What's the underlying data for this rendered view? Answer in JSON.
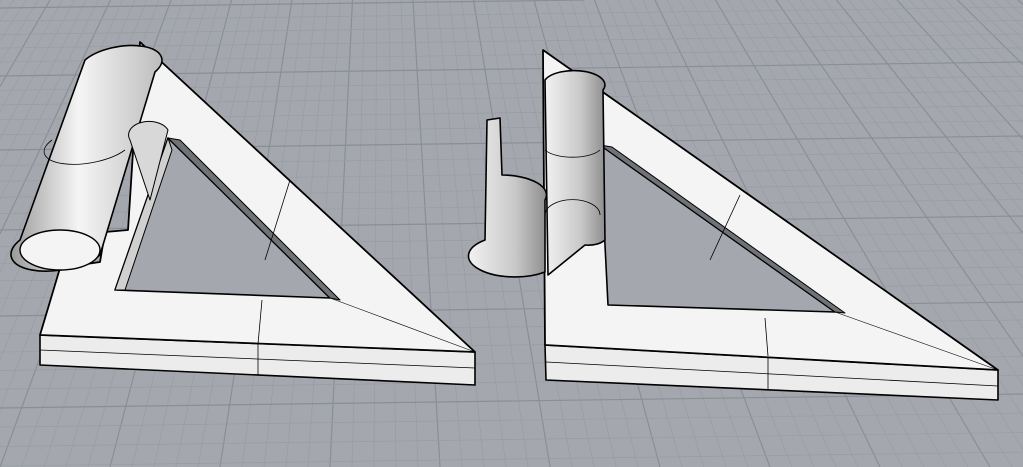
{
  "viewport": {
    "background_color": "#a4a8ae",
    "grid_minor_color": "#989ca3",
    "grid_major_color": "#8a8e95",
    "object_face_color": "#f4f4f4",
    "object_shade_color": "#c9c9c9",
    "edge_color": "#000000"
  }
}
